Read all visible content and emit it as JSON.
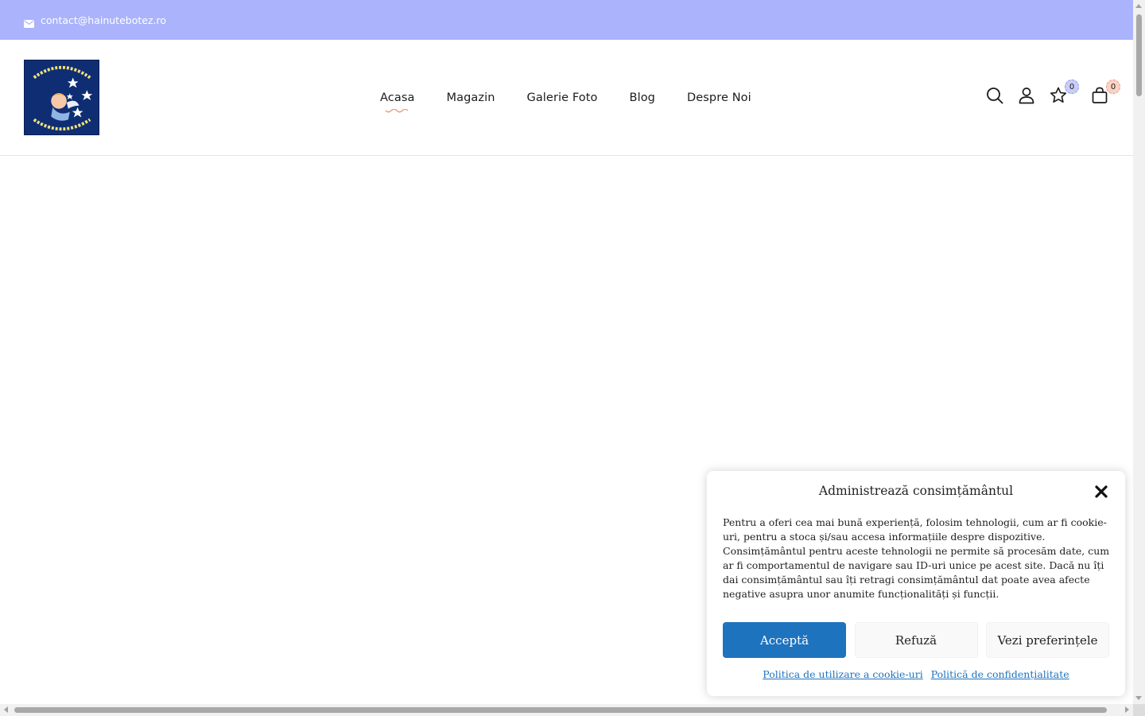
{
  "topbar": {
    "email": "contact@hainutebotez.ro",
    "icon": "mail-icon",
    "bg_color": "#aab3fb"
  },
  "header": {
    "logo": {
      "alt_top": "Regina Stelelor",
      "alt_bottom": "Bucuria copiilor !"
    },
    "nav": [
      {
        "label": "Acasa",
        "active": true
      },
      {
        "label": "Magazin",
        "active": false
      },
      {
        "label": "Galerie Foto",
        "active": false
      },
      {
        "label": "Blog",
        "active": false
      },
      {
        "label": "Despre Noi",
        "active": false
      }
    ],
    "icons": {
      "search": "search-icon",
      "account": "user-icon",
      "wishlist": "star-icon",
      "cart": "shopping-bag-icon"
    },
    "wishlist_count": "0",
    "cart_count": "0",
    "accent_color": "#ec9a80"
  },
  "cookie_banner": {
    "title": "Administrează consimțământul",
    "body": "Pentru a oferi cea mai bună experiență, folosim tehnologii, cum ar fi cookie-uri, pentru a stoca și/sau accesa informațiile despre dispozitive. Consimțământul pentru aceste tehnologii ne permite să procesăm date, cum ar fi comportamentul de navigare sau ID-uri unice pe acest site. Dacă nu îți dai consimțământul sau îți retragi consimțământul dat poate avea afecte negative asupra unor anumite funcționalități și funcții.",
    "accept_label": "Acceptă",
    "deny_label": "Refuză",
    "prefs_label": "Vezi preferințele",
    "links": [
      "Politica de utilizare a cookie-uri",
      "Politică de confidențialitate"
    ],
    "accept_color": "#1e73be"
  }
}
